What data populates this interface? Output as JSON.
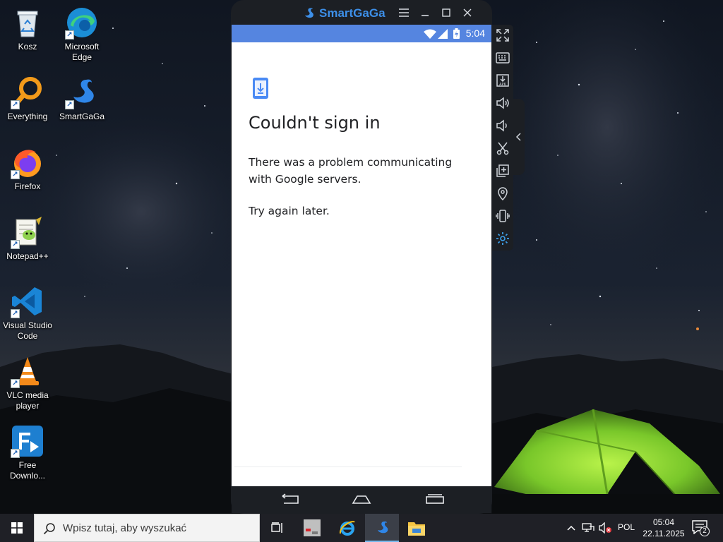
{
  "desktop": {
    "icons": [
      {
        "label": "Kosz",
        "icon": "recycle-bin-icon"
      },
      {
        "label": "Microsoft Edge",
        "icon": "edge-icon"
      },
      {
        "label": "Everything",
        "icon": "everything-search-icon"
      },
      {
        "label": "SmartGaGa",
        "icon": "smartgaga-swan-icon"
      },
      {
        "label": "Firefox",
        "icon": "firefox-icon"
      },
      {
        "label": "Notepad++",
        "icon": "notepadpp-icon"
      },
      {
        "label": "Visual Studio Code",
        "icon": "vscode-icon"
      },
      {
        "label": "VLC media player",
        "icon": "vlc-cone-icon"
      },
      {
        "label": "Free Downlo...",
        "icon": "free-download-manager-icon"
      }
    ]
  },
  "emulator": {
    "brand": "SmartGaGa",
    "status_time": "5:04",
    "dialog": {
      "title": "Couldn't sign in",
      "message": "There was a problem communicating with Google servers.",
      "hint": "Try again later."
    }
  },
  "taskbar": {
    "search_placeholder": "Wpisz tutaj, aby wyszukać",
    "language": "POL",
    "time": "05:04",
    "date": "22.11.2025",
    "notification_count": "2"
  },
  "colors": {
    "android_status_bar": "#5585e0",
    "emulator_frame": "#1c1f24",
    "brand_blue": "#3d8fe8",
    "taskbar": "#1f2026"
  }
}
